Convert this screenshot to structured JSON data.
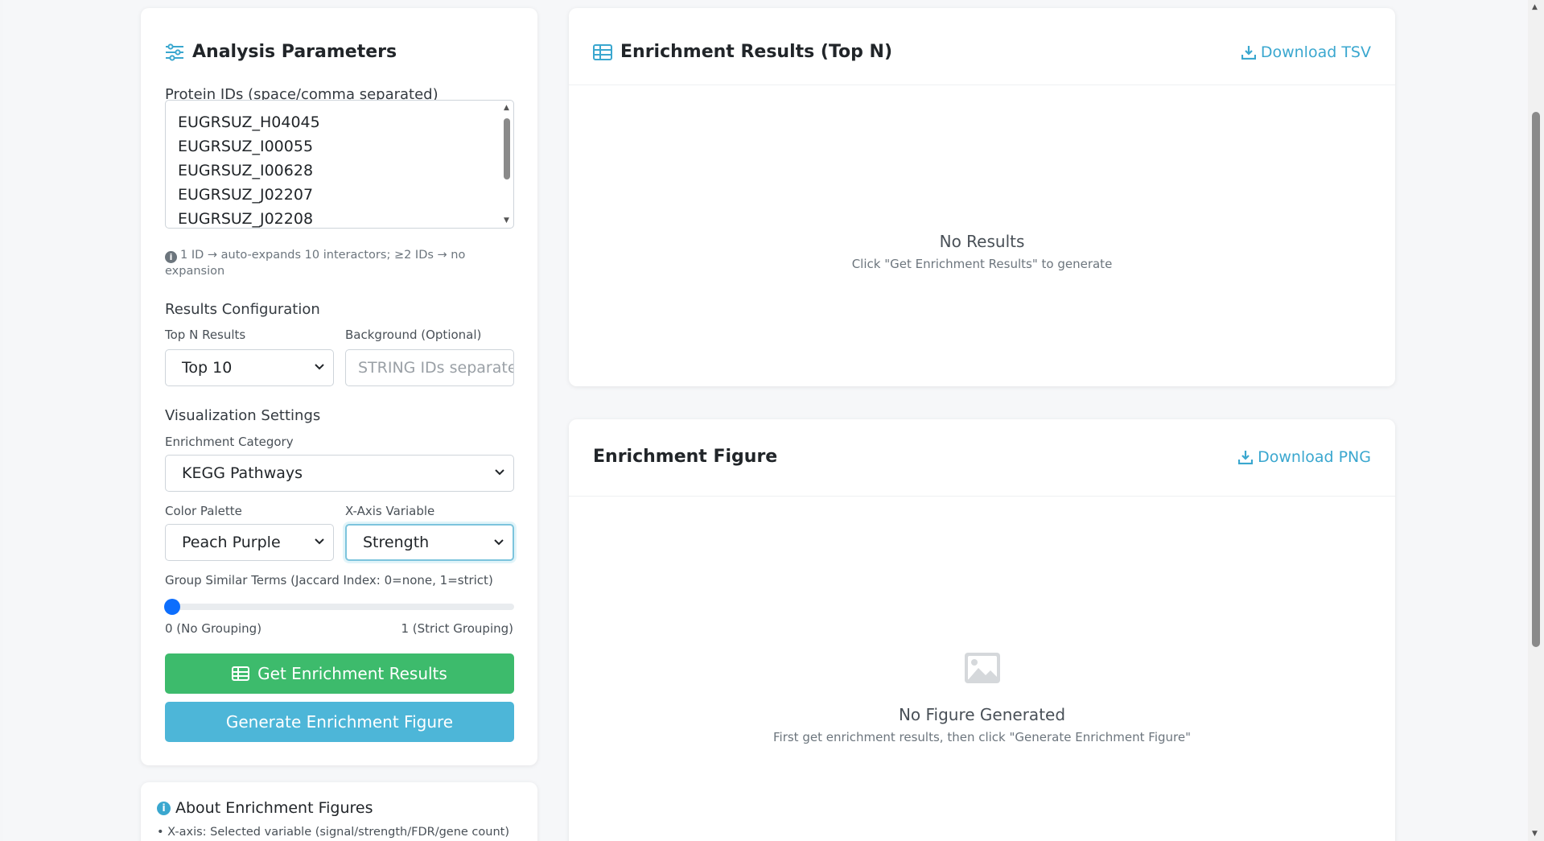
{
  "params": {
    "title": "Analysis Parameters",
    "protein_label": "Protein IDs (space/comma separated)",
    "protein_ids": [
      "EUGRSUZ_H04045",
      "EUGRSUZ_I00055",
      "EUGRSUZ_I00628",
      "EUGRSUZ_J02207",
      "EUGRSUZ_J02208"
    ],
    "hint": "1 ID → auto-expands 10 interactors; ≥2 IDs → no expansion",
    "results_config_label": "Results Configuration",
    "top_n_label": "Top N Results",
    "top_n_value": "Top 10",
    "background_label": "Background (Optional)",
    "background_placeholder": "STRING IDs separated",
    "viz_label": "Visualization Settings",
    "category_label": "Enrichment Category",
    "category_value": "KEGG Pathways",
    "palette_label": "Color Palette",
    "palette_value": "Peach Purple",
    "xaxis_label": "X-Axis Variable",
    "xaxis_value": "Strength",
    "group_label": "Group Similar Terms (Jaccard Index: 0=none, 1=strict)",
    "slider_value": 0,
    "slider_min_label": "0 (No Grouping)",
    "slider_max_label": "1 (Strict Grouping)",
    "get_results_button": "Get Enrichment Results",
    "generate_figure_button": "Generate Enrichment Figure"
  },
  "about": {
    "title": "About Enrichment Figures",
    "line1": "• X-axis: Selected variable (signal/strength/FDR/gene count)"
  },
  "results": {
    "title": "Enrichment Results (Top N)",
    "download": "Download TSV",
    "empty_title": "No Results",
    "empty_sub": "Click \"Get Enrichment Results\" to generate"
  },
  "figure": {
    "title": "Enrichment Figure",
    "download": "Download PNG",
    "empty_title": "No Figure Generated",
    "empty_sub": "First get enrichment results, then click \"Generate Enrichment Figure\""
  },
  "colors": {
    "accent": "#3aa7cf",
    "green_button": "#3dbb6c",
    "blue_button": "#4db6d8",
    "slider": "#0d6efd"
  }
}
